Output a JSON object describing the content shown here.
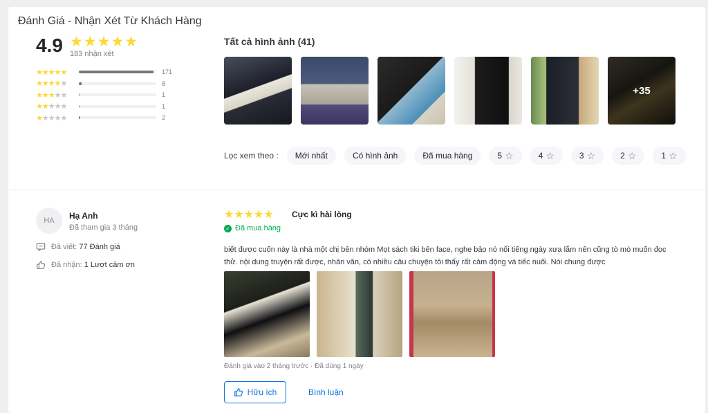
{
  "header": {
    "title": "Đánh Giá - Nhận Xét Từ Khách Hàng"
  },
  "summary": {
    "average": "4.9",
    "stars": "★★★★★",
    "review_count": "183 nhận xét",
    "distribution": [
      {
        "stars": 5,
        "count": "171",
        "fraction": 0.93
      },
      {
        "stars": 4,
        "count": "8",
        "fraction": 0.04
      },
      {
        "stars": 3,
        "count": "1",
        "fraction": 0.005
      },
      {
        "stars": 2,
        "count": "1",
        "fraction": 0.005
      },
      {
        "stars": 1,
        "count": "2",
        "fraction": 0.01
      }
    ]
  },
  "gallery": {
    "title": "Tất cả hình ảnh (41)",
    "more_label": "+35"
  },
  "filters": {
    "label": "Lọc xem theo :",
    "chips": [
      "Mới nhất",
      "Có hình ảnh",
      "Đã mua hàng"
    ],
    "star_chips": [
      "5",
      "4",
      "3",
      "2",
      "1"
    ]
  },
  "review": {
    "avatar_initials": "HA",
    "user_name": "Hạ Anh",
    "joined": "Đã tham gia 3 tháng",
    "written_label": "Đã viết:",
    "written_value": "77 Đánh giá",
    "thanks_label": "Đã nhận:",
    "thanks_value": "1 Lượt cảm ơn",
    "stars": "★★★★★",
    "title": "Cực kì hài lòng",
    "verified": "Đã mua hàng",
    "text": "biết được cuốn này là nhà một chị bên nhóm Mọt sách tiki bên face, nghe bảo nó nổi tiếng ngày xưa lắm nên cũng tò mò muốn đọc thử. nội dung truyện rất được, nhân văn, có nhiều câu chuyện tôi thấy rất cảm động và tiếc nuối. Nói chung được",
    "reviewed": "Đánh giá vào 2 tháng trước",
    "used": "Đã dùng 1 ngày",
    "helpful_label": "Hữu ích",
    "comment_label": "Bình luận"
  },
  "colors": {
    "star": "#fdd836",
    "accent": "#0b74e5",
    "verified": "#00ab56"
  }
}
